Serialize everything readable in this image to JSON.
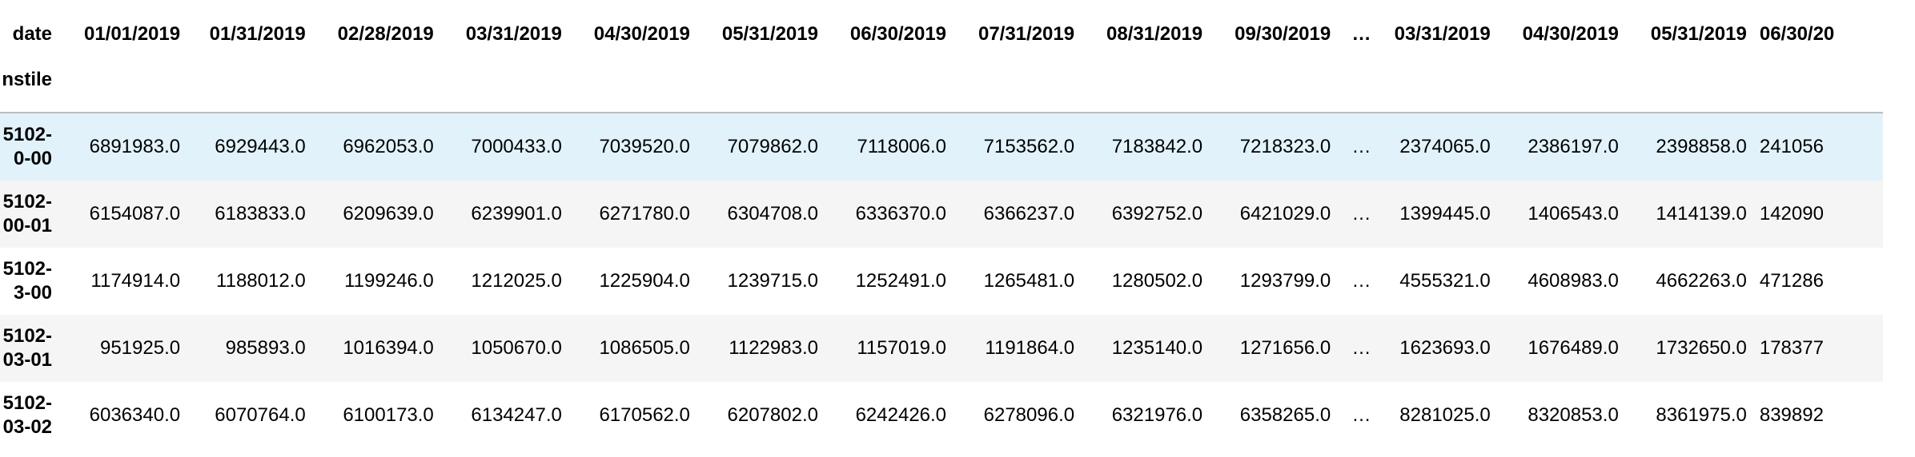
{
  "table": {
    "index_name": "date",
    "row_index_name": "nstile",
    "columns": [
      "01/01/2019",
      "01/31/2019",
      "02/28/2019",
      "03/31/2019",
      "04/30/2019",
      "05/31/2019",
      "06/30/2019",
      "07/31/2019",
      "08/31/2019",
      "09/30/2019",
      "…",
      "03/31/2019",
      "04/30/2019",
      "05/31/2019",
      "06/30/20"
    ],
    "rows": [
      {
        "index": [
          "5102-",
          "0-00"
        ],
        "values": [
          "6891983.0",
          "6929443.0",
          "6962053.0",
          "7000433.0",
          "7039520.0",
          "7079862.0",
          "7118006.0",
          "7153562.0",
          "7183842.0",
          "7218323.0",
          "…",
          "2374065.0",
          "2386197.0",
          "2398858.0",
          "241056"
        ]
      },
      {
        "index": [
          "5102-",
          "00-01"
        ],
        "values": [
          "6154087.0",
          "6183833.0",
          "6209639.0",
          "6239901.0",
          "6271780.0",
          "6304708.0",
          "6336370.0",
          "6366237.0",
          "6392752.0",
          "6421029.0",
          "…",
          "1399445.0",
          "1406543.0",
          "1414139.0",
          "142090"
        ]
      },
      {
        "index": [
          "5102-",
          "3-00"
        ],
        "values": [
          "1174914.0",
          "1188012.0",
          "1199246.0",
          "1212025.0",
          "1225904.0",
          "1239715.0",
          "1252491.0",
          "1265481.0",
          "1280502.0",
          "1293799.0",
          "…",
          "4555321.0",
          "4608983.0",
          "4662263.0",
          "471286"
        ]
      },
      {
        "index": [
          "5102-",
          "03-01"
        ],
        "values": [
          "951925.0",
          "985893.0",
          "1016394.0",
          "1050670.0",
          "1086505.0",
          "1122983.0",
          "1157019.0",
          "1191864.0",
          "1235140.0",
          "1271656.0",
          "…",
          "1623693.0",
          "1676489.0",
          "1732650.0",
          "178377"
        ]
      },
      {
        "index": [
          "5102-",
          "03-02"
        ],
        "values": [
          "6036340.0",
          "6070764.0",
          "6100173.0",
          "6134247.0",
          "6170562.0",
          "6207802.0",
          "6242426.0",
          "6278096.0",
          "6321976.0",
          "6358265.0",
          "…",
          "8281025.0",
          "8320853.0",
          "8361975.0",
          "839892"
        ]
      }
    ]
  },
  "colors": {
    "hover_row": "#e1f2fb",
    "striped_row": "#f5f5f5",
    "header_border": "#bdbdbd"
  }
}
